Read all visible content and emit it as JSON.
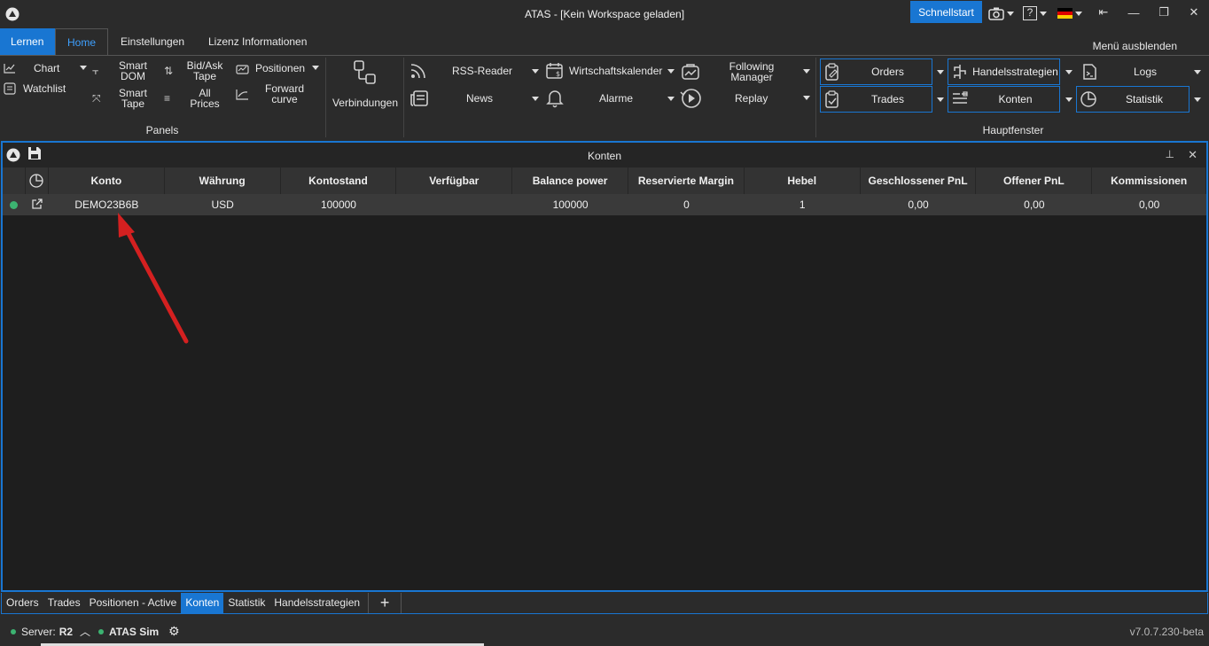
{
  "window": {
    "title": "ATAS - [Kein Workspace geladen]",
    "quickstart_label": "Schnellstart",
    "help_label": "?"
  },
  "ribbon_tabs": {
    "learn": "Lernen",
    "home": "Home",
    "settings": "Einstellungen",
    "license": "Lizenz Informationen",
    "hide_menu": "Menü ausblenden"
  },
  "panels_group": {
    "chart": "Chart",
    "watchlist": "Watchlist",
    "smart_dom": [
      "Smart",
      "DOM"
    ],
    "smart_tape": [
      "Smart",
      "Tape"
    ],
    "bidask_tape": [
      "Bid/Ask",
      "Tape"
    ],
    "all_prices": [
      "All",
      "Prices"
    ],
    "positions": "Positionen",
    "forward_curve": [
      "Forward",
      "curve"
    ],
    "label": "Panels"
  },
  "connections": {
    "label": "Verbindungen"
  },
  "tools_group": {
    "rss": "RSS-Reader",
    "news": "News",
    "calendar": "Wirtschaftskalender",
    "alarms": "Alarme",
    "following": [
      "Following",
      "Manager"
    ],
    "replay": "Replay"
  },
  "main_windows": {
    "orders": "Orders",
    "trades": "Trades",
    "strategies": "Handelsstrategien",
    "accounts": "Konten",
    "logs": "Logs",
    "statistics": "Statistik",
    "label": "Hauptfenster"
  },
  "panel": {
    "title": "Konten",
    "columns": [
      "Konto",
      "Währung",
      "Kontostand",
      "Verfügbar",
      "Balance power",
      "Reservierte Margin",
      "Hebel",
      "Geschlossener PnL",
      "Offener PnL",
      "Kommissionen"
    ],
    "row": {
      "konto": "DEMO23B6B",
      "waehrung": "USD",
      "kontostand": "100000",
      "verfuegbar": "",
      "balance_power": "100000",
      "reserved_margin": "0",
      "hebel": "1",
      "closed_pnl": "0,00",
      "open_pnl": "0,00",
      "commissions": "0,00",
      "status_color": "#3cb371"
    }
  },
  "bottom_tabs": [
    "Orders",
    "Trades",
    "Positionen - Active",
    "Konten",
    "Statistik",
    "Handelsstrategien"
  ],
  "status": {
    "server_label": "Server:",
    "server_value": "R2",
    "sim_label": "ATAS Sim",
    "version": "v7.0.7.230-beta"
  },
  "colors": {
    "accent": "#1976d2",
    "arrow": "#d42020",
    "online": "#3cb371"
  }
}
